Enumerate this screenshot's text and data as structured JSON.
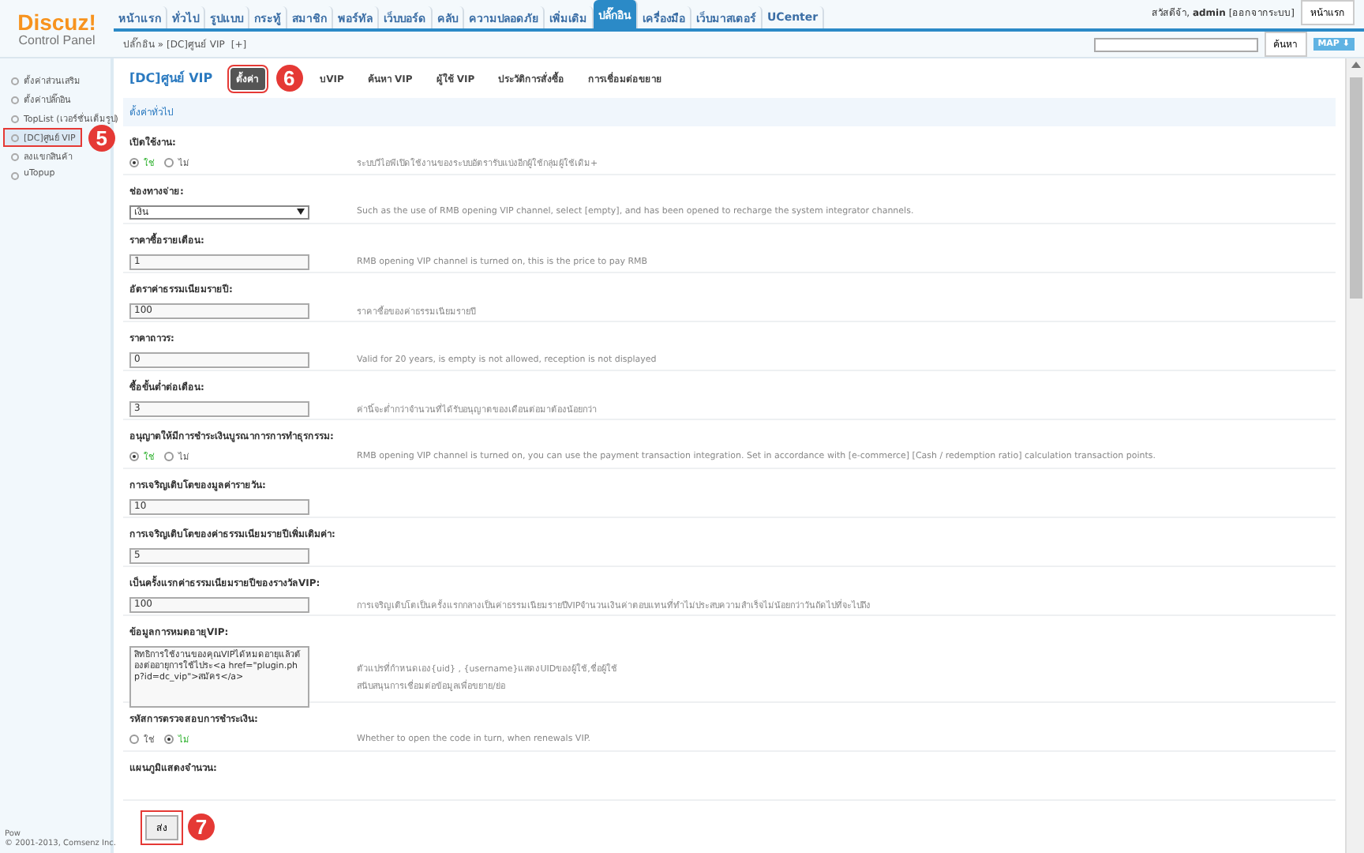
{
  "logo": {
    "title": "Discuz!",
    "subtitle": "Control Panel"
  },
  "nav": [
    {
      "label": "หน้าแรก",
      "selected": false
    },
    {
      "label": "ทั่วไป",
      "selected": false
    },
    {
      "label": "รูปแบบ",
      "selected": false
    },
    {
      "label": "กระทู้",
      "selected": false
    },
    {
      "label": "สมาชิก",
      "selected": false
    },
    {
      "label": "พอร์ทัล",
      "selected": false
    },
    {
      "label": "เว็บบอร์ด",
      "selected": false
    },
    {
      "label": "คลับ",
      "selected": false
    },
    {
      "label": "ความปลอดภัย",
      "selected": false
    },
    {
      "label": "เพิ่มเติม",
      "selected": false
    },
    {
      "label": "ปลั๊กอิน",
      "selected": true
    },
    {
      "label": "เครื่องมือ",
      "selected": false
    },
    {
      "label": "เว็บมาสเตอร์",
      "selected": false
    },
    {
      "label": "UCenter",
      "selected": false
    }
  ],
  "user": {
    "greeting": "สวัสดีจ้า,",
    "name": "admin",
    "logout": "[ออกจากระบบ]",
    "home_button": "หน้าแรก"
  },
  "breadcrumb": {
    "path": "ปลั๊กอิน » [DC]ศูนย์ VIP",
    "add": "[+]"
  },
  "search": {
    "button": "ค้นหา",
    "map": "MAP ⬇"
  },
  "sidebar": {
    "items": [
      {
        "label": "ตั้งค่าส่วนเสริม",
        "selected": false
      },
      {
        "label": "ตั้งค่าปลั๊กอิน",
        "selected": false
      },
      {
        "label": "TopList (เวอร์ชั่นเต็มรูป)",
        "selected": false
      },
      {
        "label": "[DC]ศูนย์ VIP",
        "selected": true,
        "callout": "5"
      },
      {
        "label": "ลงแขกสินค้า",
        "selected": false
      },
      {
        "label": "uTopup",
        "selected": false
      }
    ],
    "footer": [
      "Pow",
      "© 2001-2013, Comsenz Inc."
    ]
  },
  "page_title": "[DC]ศูนย์ VIP",
  "tabs": [
    {
      "label": "ตั้งค่า",
      "selected": true,
      "callout": "6"
    },
    {
      "label": "บVIP",
      "selected": false
    },
    {
      "label": "ค้นหา VIP",
      "selected": false
    },
    {
      "label": "ผู้ใช้ VIP",
      "selected": false
    },
    {
      "label": "ประวัติการสั่งซื้อ",
      "selected": false
    },
    {
      "label": "การเชื่อมต่อขยาย",
      "selected": false
    }
  ],
  "section_title": "ตั้งค่าทั่วไป",
  "settings": [
    {
      "kind": "radio",
      "label": "เปิดใช้งาน:",
      "options": [
        {
          "label": "ใช่",
          "selected": true
        },
        {
          "label": "ไม่",
          "selected": false
        }
      ],
      "description": [
        "ระบบวีไอพีเปิดใช้งานของระบบอัตรารับแบ่งอีกผู้ใช้กลุ่มผู้ใช้เดิม+"
      ]
    },
    {
      "kind": "select",
      "label": "ช่องทางจ่าย:",
      "value": "เงิน",
      "description": [
        "Such as the use of RMB opening VIP channel, select [empty], and has been opened to recharge the system integrator channels."
      ]
    },
    {
      "kind": "text",
      "label": "ราคาซื้อรายเดือน:",
      "value": "1",
      "description": [
        "RMB opening VIP channel is turned on, this is the price to pay RMB"
      ]
    },
    {
      "kind": "text",
      "label": "อัตราค่าธรรมเนียมรายปี:",
      "value": "100",
      "description": [
        "ราคาซื้อของค่าธรรมเนียมรายปี"
      ]
    },
    {
      "kind": "text",
      "label": "ราคาถาวร:",
      "value": "0",
      "description": [
        "Valid for 20 years, is empty is not allowed, reception is not displayed"
      ]
    },
    {
      "kind": "text",
      "label": "ซื้อขั้นต่ำต่อเดือน:",
      "value": "3",
      "description": [
        "ค่านี้จะต่ำกว่าจำนวนที่ได้รับอนุญาตของเดือนต่อมาต้องน้อยกว่า"
      ]
    },
    {
      "kind": "radio",
      "label": "อนุญาตให้มีการชำระเงินบูรณาการการทำธุรกรรม:",
      "options": [
        {
          "label": "ใช่",
          "selected": true
        },
        {
          "label": "ไม่",
          "selected": false
        }
      ],
      "description": [
        "RMB opening VIP channel is turned on, you can use the payment transaction integration. Set in accordance with [e-commerce] [Cash / redemption ratio] calculation transaction points."
      ]
    },
    {
      "kind": "text",
      "label": "การเจริญเติบโตของมูลค่ารายวัน:",
      "value": "10"
    },
    {
      "kind": "text",
      "label": "การเจริญเติบโตของค่าธรรมเนียมรายปีเพิ่มเติมค่า:",
      "value": "5"
    },
    {
      "kind": "text",
      "label": "เป็นครั้งแรกค่าธรรมเนียมรายปีของรางวัลVIP:",
      "value": "100",
      "description": [
        "การเจริญเติบโตเป็นครั้งแรกกลางเป็นค่าธรรมเนียมรายปีVIPจำนวนเงินค่าตอบแทนที่ทำไม่ประสบความสำเร็จไม่น้อยกว่าวันถัดไปที่จะไปถึง"
      ]
    },
    {
      "kind": "textarea",
      "label": "ข้อมูลการหมดอายุVIP:",
      "value": "สิทธิการใช้งานของคุณVIPได้หมดอายุแล้วต้องต่ออายุการใช้ไประ<a href=\"plugin.php?id=dc_vip\">สมัคร</a>",
      "description": [
        "ตัวแปรที่กำหนดเอง{uid} , {username}แสดงUIDของผู้ใช้,ชื่อผู้ใช้",
        "สนับสนุนการเชื่อมต่อข้อมูลเพื่อขยาย/ย่อ"
      ]
    },
    {
      "kind": "radio",
      "label": "รหัสการตรวจสอบการชำระเงิน:",
      "options": [
        {
          "label": "ใช่",
          "selected": false
        },
        {
          "label": "ไม่",
          "selected": true
        }
      ],
      "description": [
        "Whether to open the code in turn, when renewals VIP."
      ]
    },
    {
      "kind": "heading",
      "label": "แผนภูมิแสดงจำนวน:"
    }
  ],
  "submit": {
    "label": "ส่ง",
    "callout": "7"
  }
}
